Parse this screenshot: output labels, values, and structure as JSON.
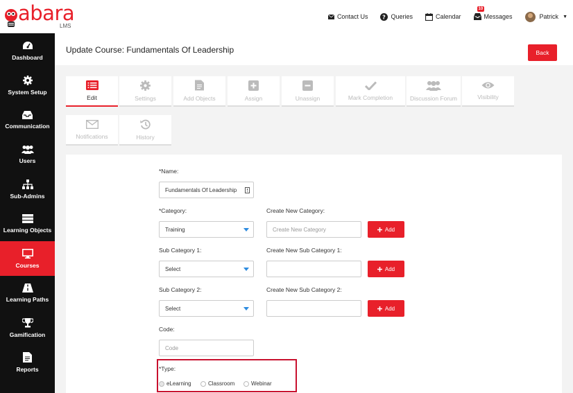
{
  "brand": {
    "logo_word": "abara",
    "logo_sub": "LMS"
  },
  "topnav": {
    "contact": "Contact Us",
    "queries": "Queries",
    "calendar": "Calendar",
    "messages": "Messages",
    "messages_badge": "10",
    "user": "Patrick"
  },
  "sidebar": {
    "items": [
      {
        "label": "Dashboard"
      },
      {
        "label": "System Setup"
      },
      {
        "label": "Communication"
      },
      {
        "label": "Users"
      },
      {
        "label": "Sub-Admins"
      },
      {
        "label": "Learning Objects"
      },
      {
        "label": "Courses"
      },
      {
        "label": "Learning Paths"
      },
      {
        "label": "Gamification"
      },
      {
        "label": "Reports"
      }
    ],
    "active": "Courses"
  },
  "page": {
    "title": "Update Course: Fundamentals Of Leadership",
    "back": "Back"
  },
  "tabs": [
    {
      "label": "Edit"
    },
    {
      "label": "Settings"
    },
    {
      "label": "Add Objects"
    },
    {
      "label": "Assign"
    },
    {
      "label": "Unassign"
    },
    {
      "label": "Mark Completion"
    },
    {
      "label": "Discussion Forum"
    },
    {
      "label": "Visibility"
    },
    {
      "label": "Notifications"
    },
    {
      "label": "History"
    }
  ],
  "form": {
    "name_label": "*Name:",
    "name_value": "Fundamentals Of Leadership",
    "category_label": "*Category:",
    "category_value": "Training",
    "new_category_label": "Create New Category:",
    "new_category_placeholder": "Create New Category",
    "sub1_label": "Sub Category 1:",
    "sub1_value": "Select",
    "new_sub1_label": "Create New Sub Category 1:",
    "sub2_label": "Sub Category 2:",
    "sub2_value": "Select",
    "new_sub2_label": "Create New Sub Category 2:",
    "add": "Add",
    "code_label": "Code:",
    "code_placeholder": "Code",
    "type_label": "*Type:",
    "type_options": [
      "eLearning",
      "Classroom",
      "Webinar"
    ],
    "type_selected": "eLearning"
  },
  "colors": {
    "accent": "#e8202a",
    "sidebar": "#111111",
    "select_arrow": "#2e8ce0"
  }
}
